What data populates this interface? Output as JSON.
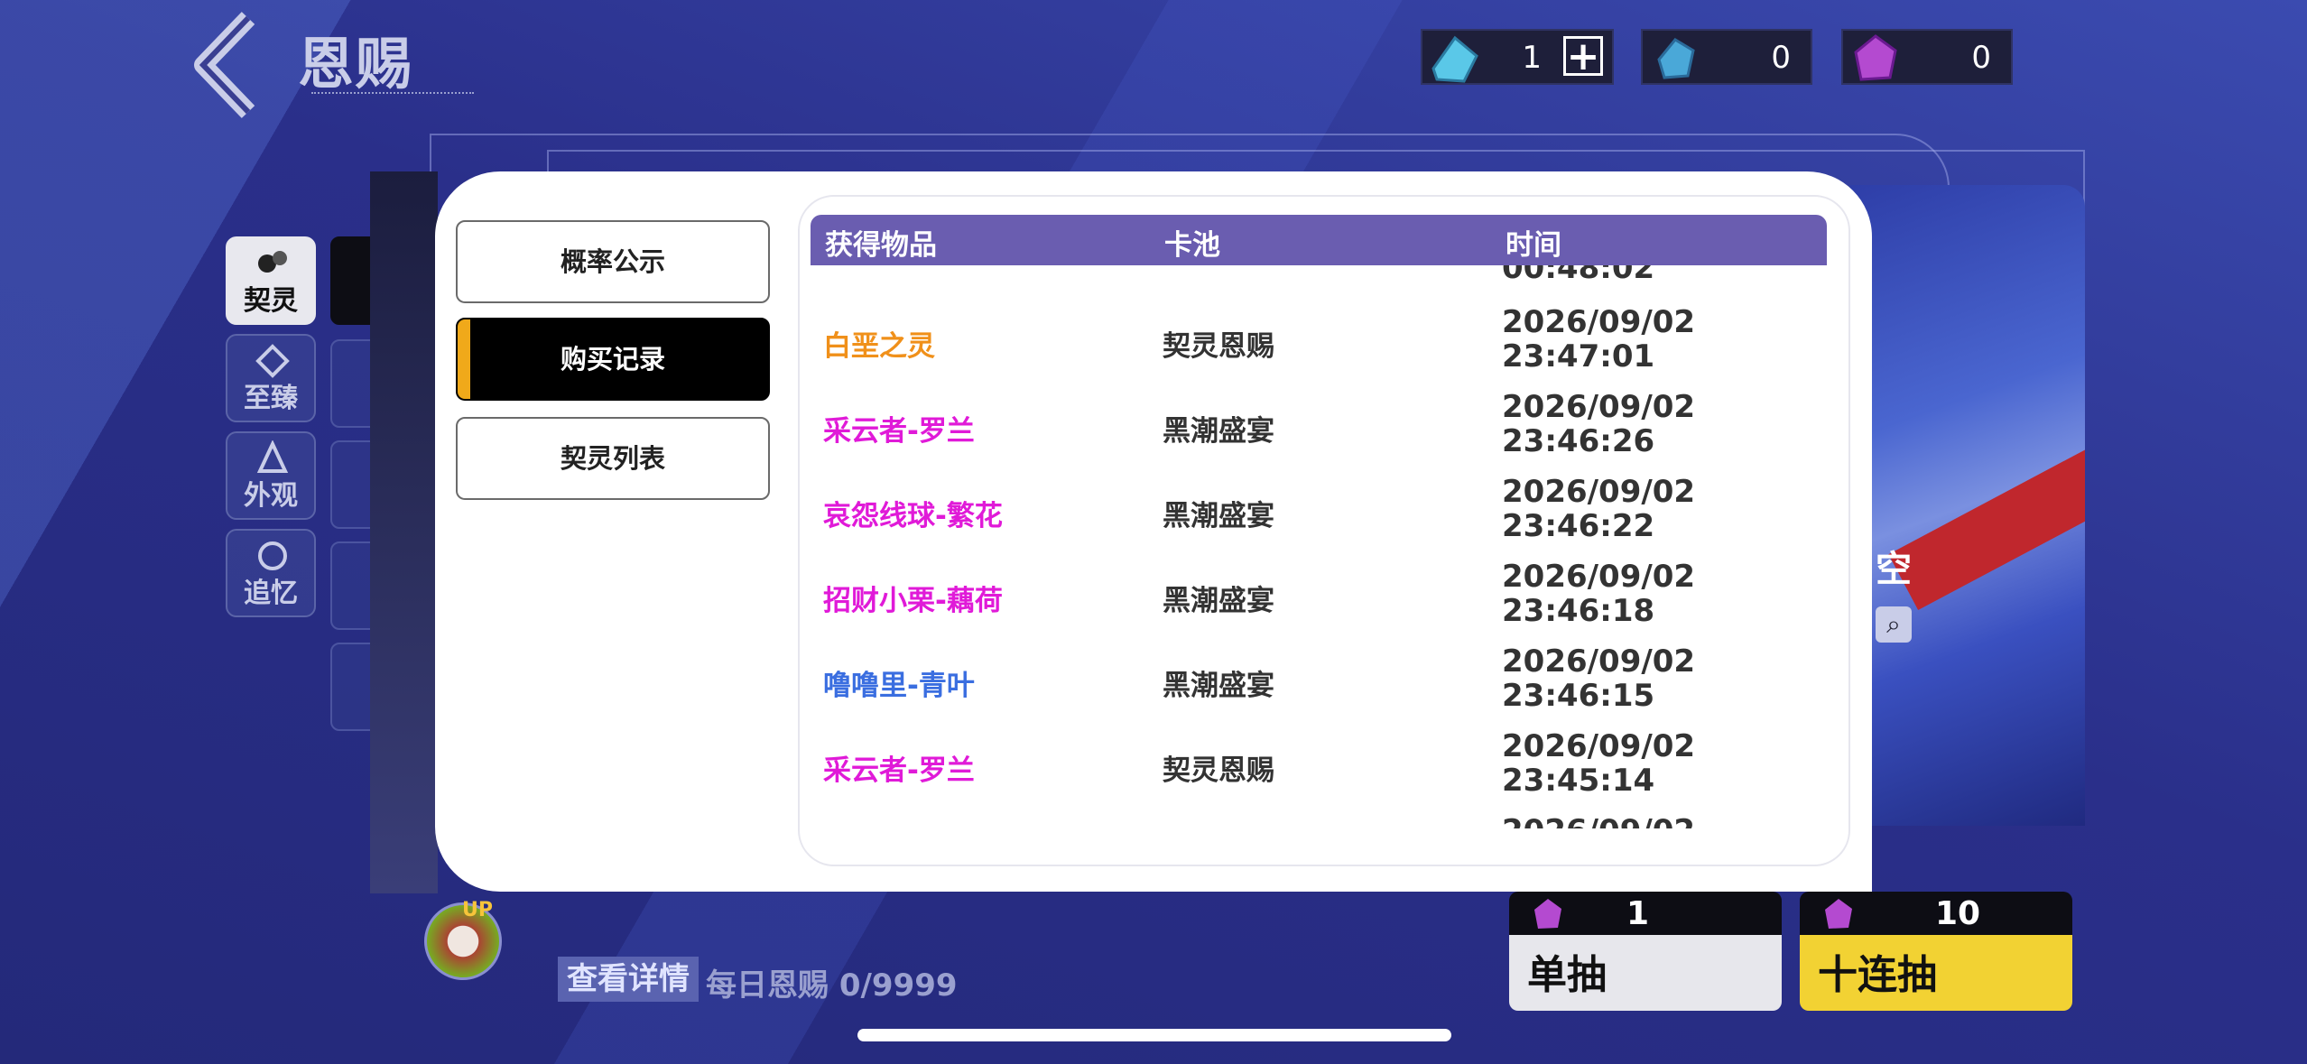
{
  "header": {
    "title": "恩赐"
  },
  "resources": [
    {
      "icon": "blue-crystal-ticket-icon",
      "value": "1"
    },
    {
      "icon": "blue-crystal-shard-icon",
      "value": "0"
    },
    {
      "icon": "purple-gem-icon",
      "value": "0"
    }
  ],
  "left_tabs": [
    {
      "label": "契灵",
      "icon": "contract-spirit-icon"
    },
    {
      "label": "至臻",
      "icon": "supreme-icon"
    },
    {
      "label": "外观",
      "icon": "appearance-icon"
    },
    {
      "label": "追忆",
      "icon": "memory-icon"
    }
  ],
  "modal": {
    "side_buttons": [
      {
        "label": "概率公示"
      },
      {
        "label": "购买记录"
      },
      {
        "label": "契灵列表"
      }
    ],
    "active_side": "购买记录",
    "table": {
      "headers": [
        "获得物品",
        "卡池",
        "时间"
      ],
      "partial_top_time": "00:48:02",
      "rows": [
        {
          "item": "白垩之灵",
          "color": "#f0901a",
          "pool": "契灵恩赐",
          "date": "2026/09/02",
          "time": "23:47:01"
        },
        {
          "item": "采云者-罗兰",
          "color": "#e01ad8",
          "pool": "黑潮盛宴",
          "date": "2026/09/02",
          "time": "23:46:26"
        },
        {
          "item": "哀怨线球-繁花",
          "color": "#e01ad8",
          "pool": "黑潮盛宴",
          "date": "2026/09/02",
          "time": "23:46:22"
        },
        {
          "item": "招财小栗-藕荷",
          "color": "#e01ad8",
          "pool": "黑潮盛宴",
          "date": "2026/09/02",
          "time": "23:46:18"
        },
        {
          "item": "噜噜里-青叶",
          "color": "#3a6ee0",
          "pool": "黑潮盛宴",
          "date": "2026/09/02",
          "time": "23:46:15"
        },
        {
          "item": "采云者-罗兰",
          "color": "#e01ad8",
          "pool": "契灵恩赐",
          "date": "2026/09/02",
          "time": "23:45:14"
        }
      ],
      "partial_bottom_date": "2026/09/02"
    }
  },
  "banner": {
    "text": "空"
  },
  "bottom": {
    "up_tag": "UP",
    "detail_label": "查看详情",
    "daily_text": "每日恩赐 0/9999",
    "single": {
      "label": "单抽",
      "count": "1"
    },
    "ten": {
      "label": "十连抽",
      "count": "10"
    }
  },
  "colors": {
    "header_bar": "#6a5db0",
    "active_accent": "#f0a91a",
    "ten_draw": "#f2d233"
  }
}
